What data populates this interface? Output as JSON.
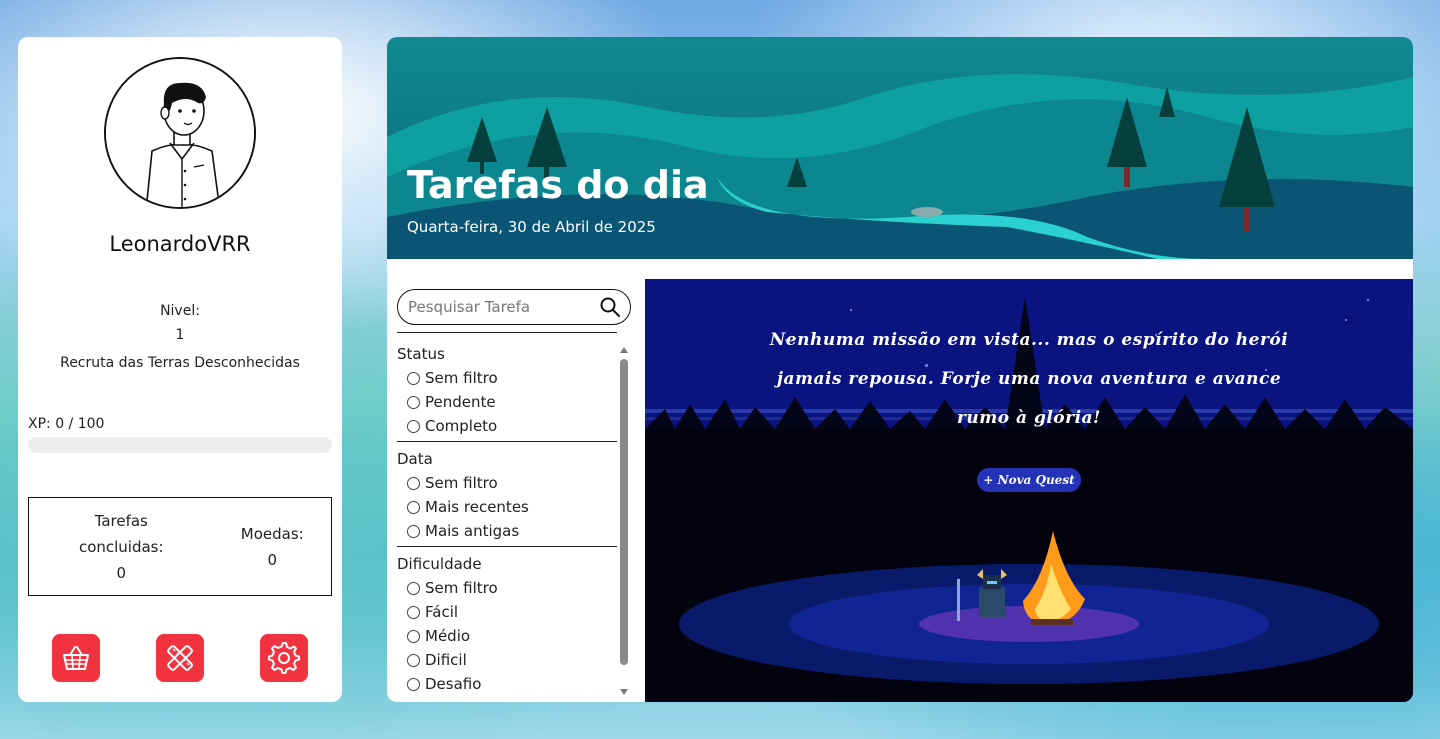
{
  "profile": {
    "username": "LeonardoVRR",
    "level_label": "Nivel:",
    "level_value": "1",
    "level_title": "Recruta das Terras Desconhecidas",
    "xp_text": "XP: 0 / 100",
    "xp_progress_fraction": 0,
    "stats": {
      "tasks_label": "Tarefas concluidas:",
      "tasks_value": "0",
      "coins_label": "Moedas:",
      "coins_value": "0"
    },
    "actions": [
      {
        "icon": "basket-icon"
      },
      {
        "icon": "tools-icon"
      },
      {
        "icon": "gear-icon"
      }
    ]
  },
  "banner": {
    "title": "Tarefas do dia",
    "date": "Quarta-feira, 30 de Abril de 2025"
  },
  "filters": {
    "search_placeholder": "Pesquisar Tarefa",
    "groups": [
      {
        "title": "Status",
        "options": [
          "Sem filtro",
          "Pendente",
          "Completo"
        ]
      },
      {
        "title": "Data",
        "options": [
          "Sem filtro",
          "Mais recentes",
          "Mais antigas"
        ]
      },
      {
        "title": "Dificuldade",
        "options": [
          "Sem filtro",
          "Fácil",
          "Médio",
          "Dificil",
          "Desafio"
        ]
      }
    ]
  },
  "quest": {
    "message": "Nenhuma missão em vista... mas o espírito do herói jamais repousa. Forje uma nova aventura e avance rumo à glória!",
    "button_label": "+ Nova Quest"
  },
  "colors": {
    "accent": "#f2323f",
    "quest_bg": "#0a1480",
    "quest_button": "#2432b8"
  }
}
